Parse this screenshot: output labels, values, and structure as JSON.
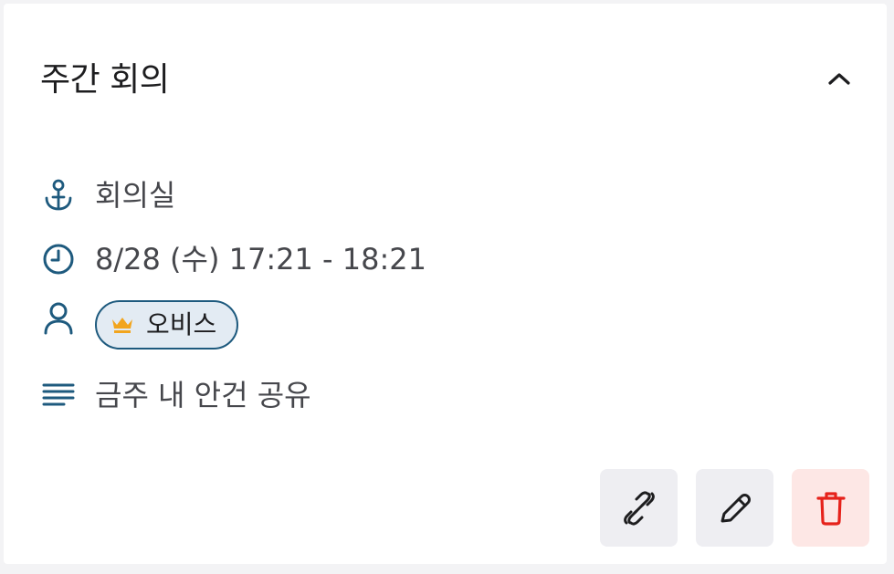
{
  "event": {
    "title": "주간 회의",
    "location": "회의실",
    "datetime": "8/28 (수) 17:21 - 18:21",
    "attendees": [
      {
        "name": "오비스",
        "role_icon": "crown-icon",
        "is_host": true
      }
    ],
    "description": "금주 내 안건 공유"
  },
  "icons": {
    "collapse": "chevron-up-icon",
    "location": "anchor-icon",
    "time": "clock-icon",
    "attendees": "person-icon",
    "description": "text-lines-icon",
    "copy_link": "link-icon",
    "edit": "pencil-icon",
    "delete": "trash-icon"
  },
  "colors": {
    "accent": "#1e5a7e",
    "chip_background": "#e3ebf3",
    "crown": "#f2a51e",
    "delete": "#e6221b",
    "delete_background": "#fde7e5",
    "button_background": "#eeeef2"
  }
}
